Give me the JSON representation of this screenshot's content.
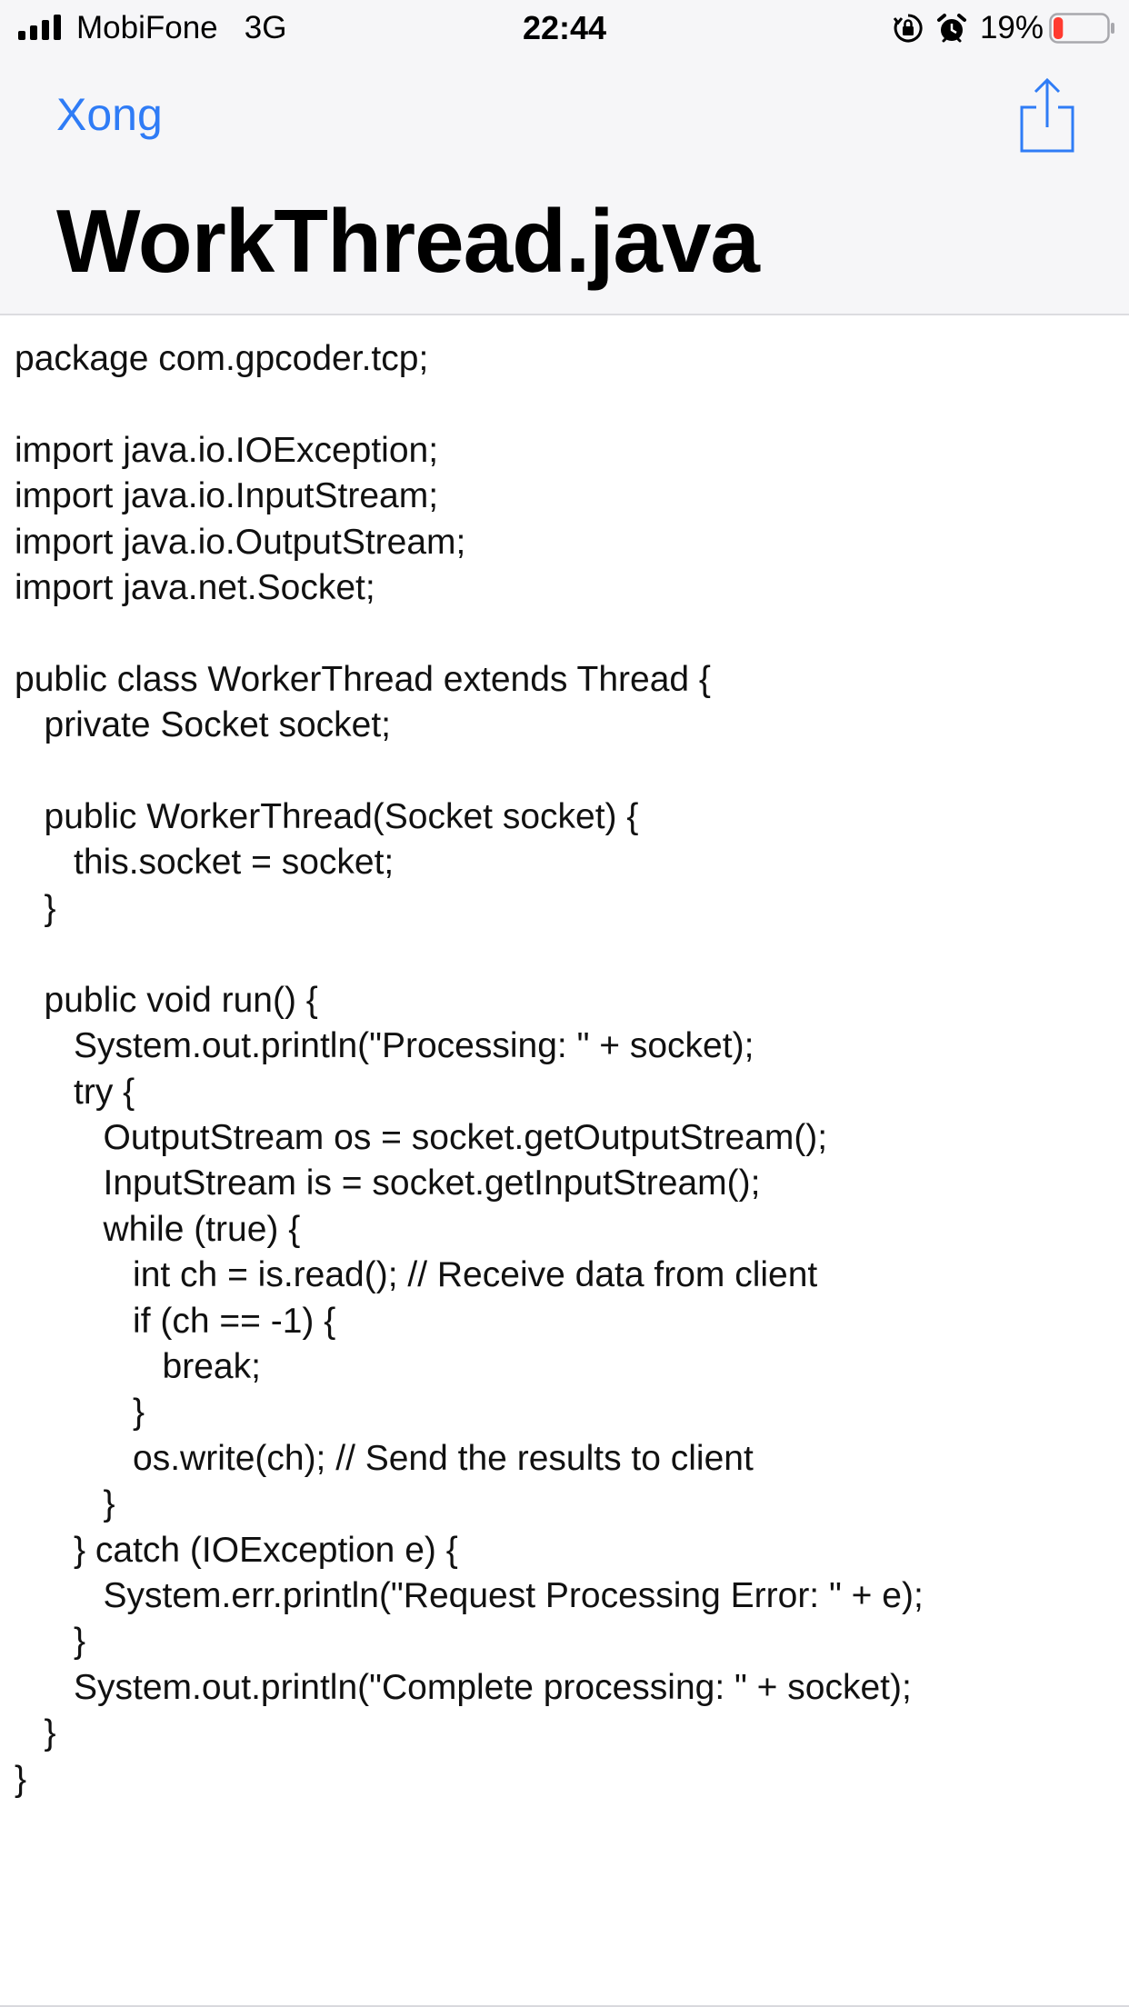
{
  "status_bar": {
    "carrier": "MobiFone   3G",
    "time": "22:44",
    "battery_percent": "19%",
    "battery_level": 0.19,
    "battery_color": "#ff3b30",
    "icons": [
      "signal-bars-icon",
      "orientation-lock-icon",
      "alarm-icon",
      "battery-icon"
    ]
  },
  "nav": {
    "done_label": "Xong",
    "share_icon": "share-icon",
    "accent_color": "#2f7cf6"
  },
  "document": {
    "title": "WorkThread.java",
    "code": "package com.gpcoder.tcp;\n\nimport java.io.IOException;\nimport java.io.InputStream;\nimport java.io.OutputStream;\nimport java.net.Socket;\n\npublic class WorkerThread extends Thread {\n   private Socket socket;\n\n   public WorkerThread(Socket socket) {\n      this.socket = socket;\n   }\n\n   public void run() {\n      System.out.println(\"Processing: \" + socket);\n      try {\n         OutputStream os = socket.getOutputStream();\n         InputStream is = socket.getInputStream();\n         while (true) {\n            int ch = is.read(); // Receive data from client\n            if (ch == -1) {\n               break;\n            }\n            os.write(ch); // Send the results to client\n         }\n      } catch (IOException e) {\n         System.err.println(\"Request Processing Error: \" + e);\n      }\n      System.out.println(\"Complete processing: \" + socket);\n   }\n}"
  }
}
